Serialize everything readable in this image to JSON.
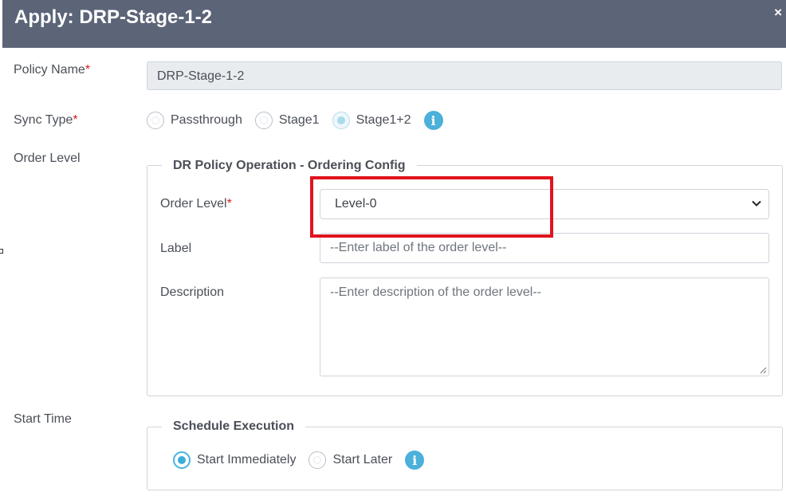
{
  "dialog": {
    "title": "Apply: DRP-Stage-1-2",
    "close_icon": "×"
  },
  "form": {
    "policy_name": {
      "label": "Policy Name",
      "required_mark": "*",
      "value": "DRP-Stage-1-2"
    },
    "sync_type": {
      "label": "Sync Type",
      "required_mark": "*",
      "options": [
        "Passthrough",
        "Stage1",
        "Stage1+2"
      ],
      "selected": "Stage1+2",
      "info_icon": "i"
    },
    "order_level_section": {
      "label": "Order Level",
      "legend": "DR Policy Operation - Ordering Config",
      "order_level": {
        "label": "Order Level",
        "required_mark": "*",
        "selected": "Level-0"
      },
      "label_field": {
        "label": "Label",
        "placeholder": "--Enter label of the order level--"
      },
      "description": {
        "label": "Description",
        "placeholder": "--Enter description of the order level--"
      }
    },
    "start_time": {
      "label": "Start Time",
      "legend": "Schedule Execution",
      "options": [
        "Start Immediately",
        "Start Later"
      ],
      "selected": "Start Immediately",
      "info_icon": "i"
    }
  },
  "colors": {
    "header_bg": "#5c6478",
    "accent": "#4bb0da",
    "required": "#d32020",
    "highlight": "#e0141e"
  }
}
